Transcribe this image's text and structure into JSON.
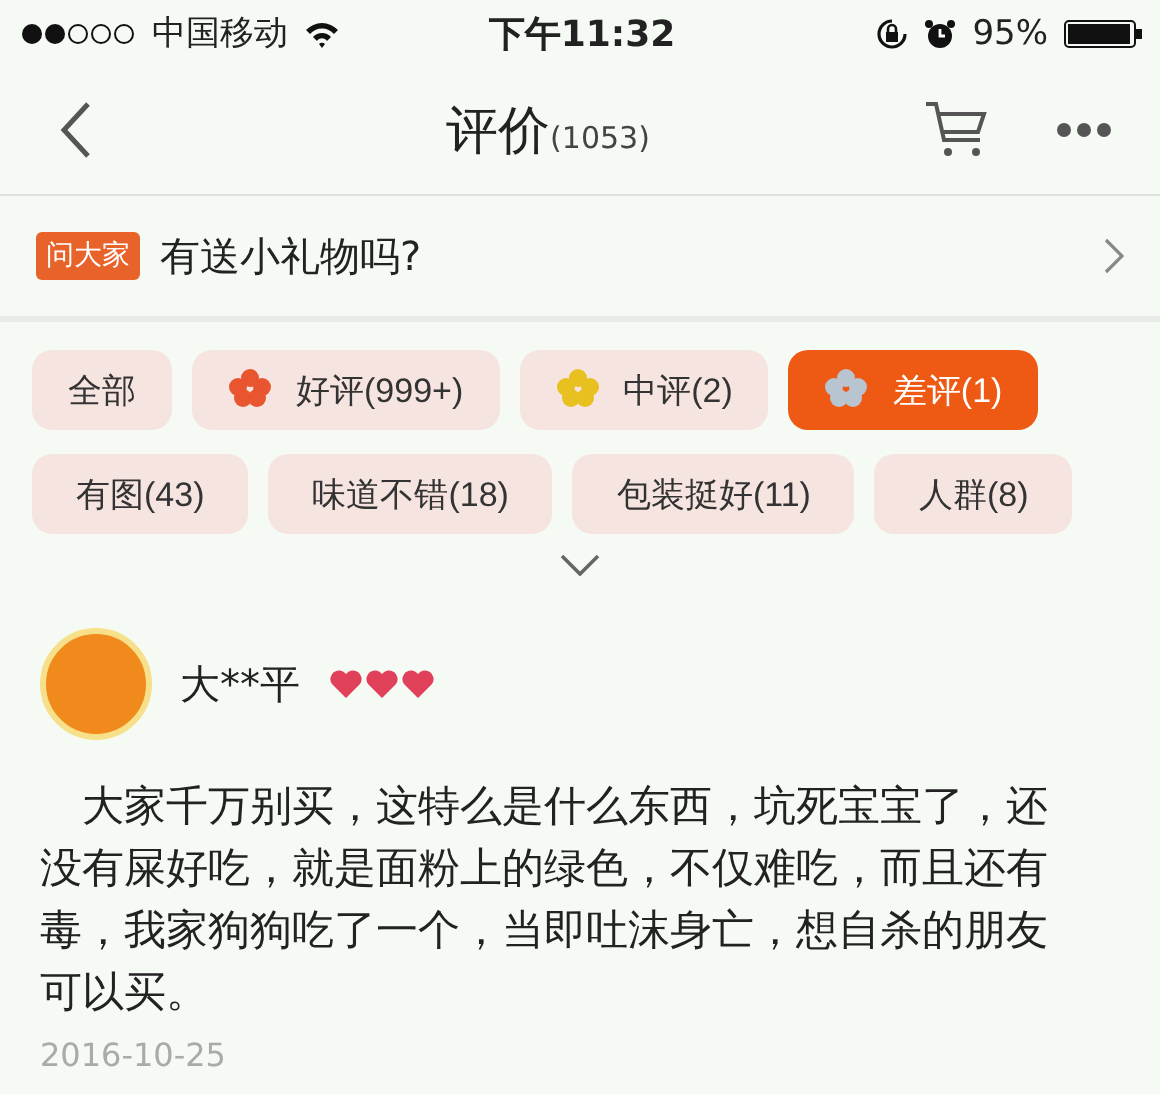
{
  "status_bar": {
    "carrier": "中国移动",
    "time": "下午11:32",
    "battery": "95%"
  },
  "nav": {
    "title": "评价",
    "count": "(1053)"
  },
  "ask": {
    "badge": "问大家",
    "question": "有送小礼物吗?"
  },
  "filters": [
    {
      "label": "全部",
      "kind": "plain",
      "selected": false
    },
    {
      "label": "好评(999+)",
      "kind": "flower",
      "color": "#e8552e",
      "selected": false
    },
    {
      "label": "中评(2)",
      "kind": "flower",
      "color": "#e8c020",
      "selected": false
    },
    {
      "label": "差评(1)",
      "kind": "flower",
      "color": "#b8c4d0",
      "selected": true
    }
  ],
  "tags": [
    {
      "label": "有图(43)"
    },
    {
      "label": "味道不错(18)"
    },
    {
      "label": "包装挺好(11)"
    },
    {
      "label": "人群(8)"
    }
  ],
  "review": {
    "user": "大**平",
    "text": "大家千万别买，这特么是什么东西，坑死宝宝了，还没有屎好吃，就是面粉上的绿色，不仅难吃，而且还有毒，我家狗狗吃了一个，当即吐沫身亡，想自杀的朋友可以买。",
    "date": "2016-10-25"
  }
}
